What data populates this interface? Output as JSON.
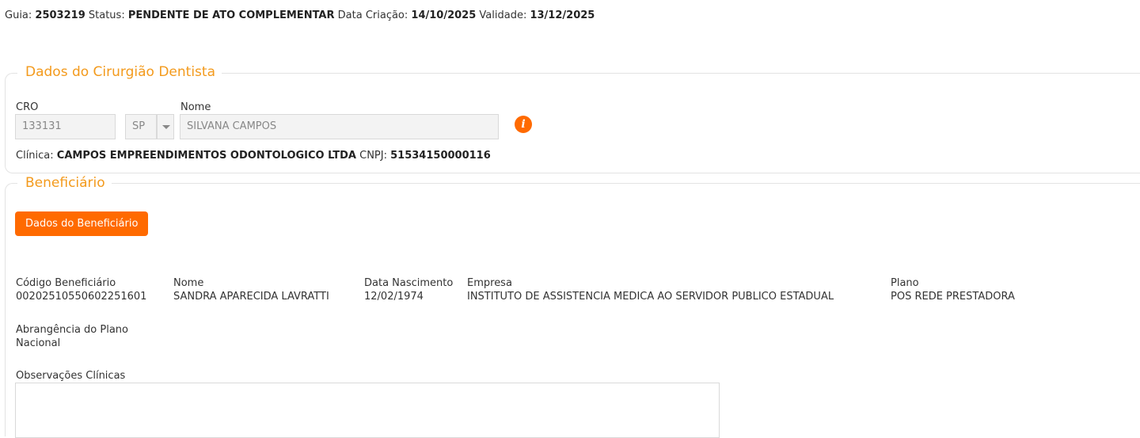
{
  "header": {
    "guia_label": "Guia:",
    "guia_value": "2503219",
    "status_label": "Status:",
    "status_value": "PENDENTE DE ATO COMPLEMENTAR",
    "criacao_label": "Data Criação:",
    "criacao_value": "14/10/2025",
    "validade_label": "Validade:",
    "validade_value": "13/12/2025"
  },
  "dentista": {
    "legend": "Dados do Cirurgião Dentista",
    "cro_label": "CRO",
    "cro_value": "133131",
    "uf_value": "SP",
    "nome_label": "Nome",
    "nome_value": "SILVANA CAMPOS",
    "info_icon": "info-icon",
    "clinica_label": "Clínica:",
    "clinica_value": "CAMPOS EMPREENDIMENTOS ODONTOLOGICO LTDA",
    "cnpj_label": "CNPJ:",
    "cnpj_value": "51534150000116"
  },
  "beneficiario": {
    "legend": "Beneficiário",
    "button_label": "Dados do Beneficiário",
    "codigo_label": "Código Beneficiário",
    "codigo_value": "00202510550602251601",
    "nome_label": "Nome",
    "nome_value": "SANDRA APARECIDA LAVRATTI",
    "nascimento_label": "Data Nascimento",
    "nascimento_value": "12/02/1974",
    "empresa_label": "Empresa",
    "empresa_value": "INSTITUTO DE ASSISTENCIA MEDICA AO SERVIDOR PUBLICO ESTADUAL",
    "plano_label": "Plano",
    "plano_value": "POS REDE PRESTADORA",
    "abrangencia_label": "Abrangência do Plano",
    "abrangencia_value": "Nacional",
    "observacoes_label": "Observações Clínicas",
    "observacoes_value": ""
  },
  "colors": {
    "accent": "#ff6a00",
    "legend": "#f39a1c"
  }
}
